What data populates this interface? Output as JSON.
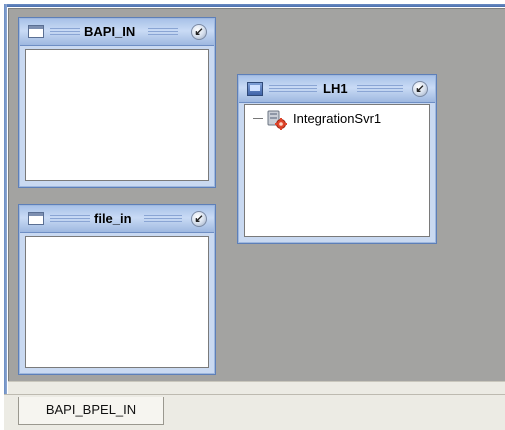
{
  "windows": {
    "bapi_in": {
      "title": "BAPI_IN",
      "close_glyph": "↙"
    },
    "lh1": {
      "title": "LH1",
      "close_glyph": "↙",
      "tree": [
        {
          "label": "IntegrationSvr1",
          "icon": "server-icon"
        }
      ]
    },
    "file_in": {
      "title": "file_in",
      "close_glyph": "↙"
    }
  },
  "tabs": [
    {
      "label": "BAPI_BPEL_IN",
      "active": true
    }
  ],
  "colors": {
    "workspace": "#a3a3a1",
    "frame_title": "#b7cdef",
    "frame_border": "#5d7fb8",
    "tabbar": "#ecebe4"
  }
}
